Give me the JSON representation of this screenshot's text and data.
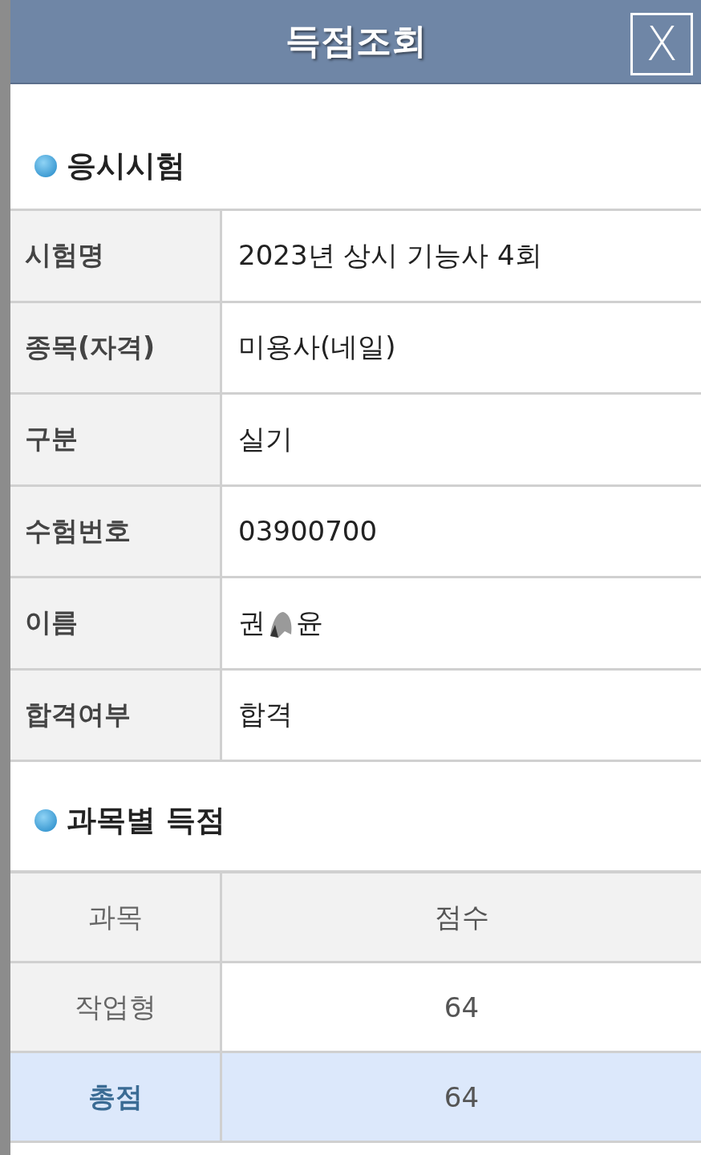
{
  "window": {
    "title": "득점조회",
    "close": "X"
  },
  "exam_section": {
    "heading": "응시시험",
    "rows": [
      {
        "label": "시험명",
        "value": "2023년 상시 기능사 4회"
      },
      {
        "label": "종목(자격)",
        "value": "미용사(네일)"
      },
      {
        "label": "구분",
        "value": "실기"
      },
      {
        "label": "수험번호",
        "value": "03900700"
      },
      {
        "label": "이름",
        "value_parts": [
          "권",
          "윤"
        ],
        "redacted": true
      },
      {
        "label": "합격여부",
        "value": "합격"
      }
    ]
  },
  "score_section": {
    "heading": "과목별 득점",
    "columns": [
      "과목",
      "점수"
    ],
    "rows": [
      {
        "subject": "작업형",
        "score": "64",
        "kind": "subject"
      },
      {
        "subject": "총점",
        "score": "64",
        "kind": "total"
      }
    ]
  }
}
